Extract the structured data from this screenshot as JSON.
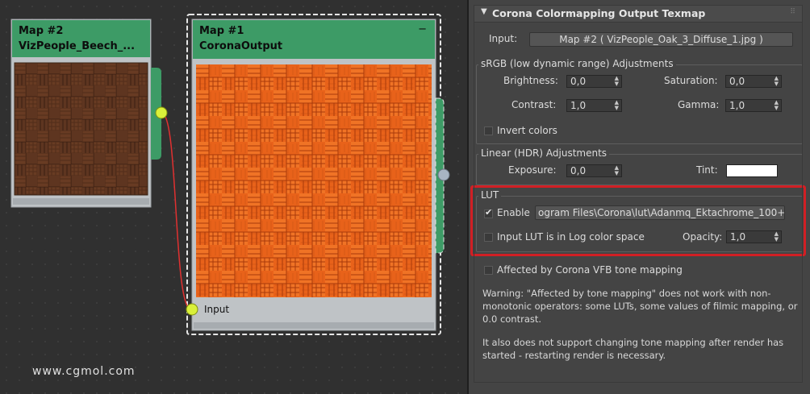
{
  "watermark": "www.cgmol.com",
  "node_left": {
    "title_line1": "Map #2",
    "title_line2": "VizPeople_Beech_..."
  },
  "node_right": {
    "title_line1": "Map #1",
    "title_line2": "CoronaOutput",
    "minimize_glyph": "−",
    "input_label": "Input"
  },
  "panel": {
    "rollout_title": "Corona Colormapping Output Texmap",
    "input_label": "Input:",
    "input_map": "Map #2  ( VizPeople_Oak_3_Diffuse_1.jpg )",
    "srgb": {
      "title": "sRGB (low dynamic range) Adjustments",
      "brightness_label": "Brightness:",
      "brightness": "0,0",
      "saturation_label": "Saturation:",
      "saturation": "0,0",
      "contrast_label": "Contrast:",
      "contrast": "1,0",
      "gamma_label": "Gamma:",
      "gamma": "1,0",
      "invert_label": "Invert colors"
    },
    "linear": {
      "title": "Linear (HDR) Adjustments",
      "exposure_label": "Exposure:",
      "exposure": "0,0",
      "tint_label": "Tint:",
      "tint_color": "#ffffff"
    },
    "lut": {
      "title": "LUT",
      "enable_label": "Enable",
      "enable_checked": true,
      "path": "ogram Files\\Corona\\lut\\Adanmq_Ektachrome_100+",
      "log_label": "Input LUT is in Log color space",
      "opacity_label": "Opacity:",
      "opacity": "1,0"
    },
    "affected_label": "Affected by Corona VFB tone mapping",
    "warning1": "Warning: \"Affected by tone mapping\" does not work with non-monotonic operators: some LUTs, some values of filmic mapping, or 0.0 contrast.",
    "warning2": "It also does not support changing tone mapping after render has started - restarting render is necessary."
  },
  "colors": {
    "node_header": "#3d9b66",
    "highlight": "#d11f24",
    "socket": "#d9f03a",
    "wire": "#e03030"
  }
}
